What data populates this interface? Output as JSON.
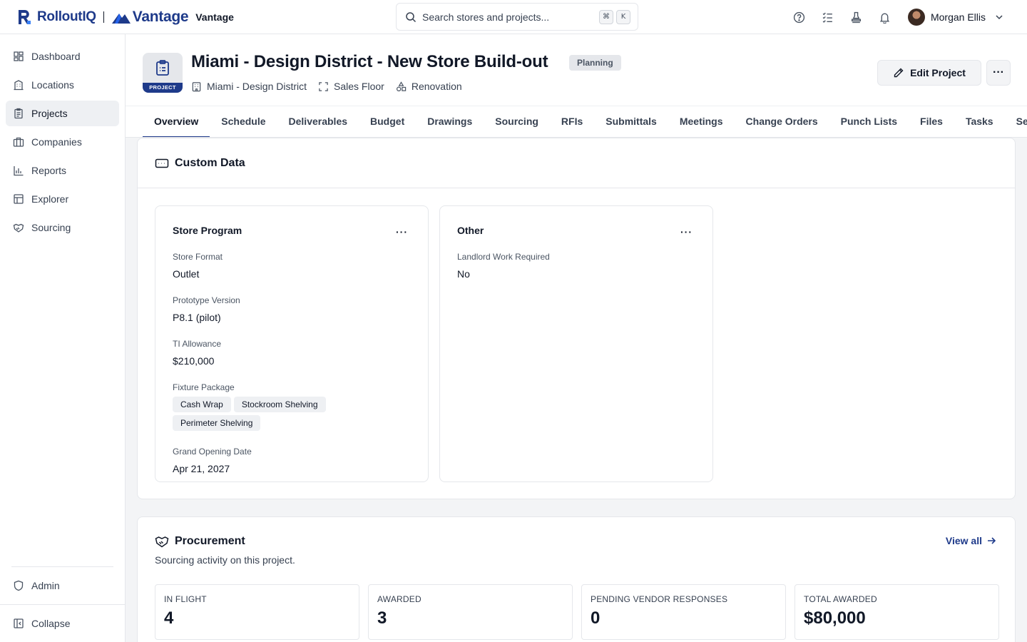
{
  "brand": {
    "name": "RolloutIQ",
    "partner_name": "Vantage",
    "partner_sub": "Vantage"
  },
  "search": {
    "placeholder": "Search stores and projects...",
    "shortcut_key1": "⌘",
    "shortcut_key2": "K"
  },
  "user": {
    "name": "Morgan Ellis"
  },
  "sidebar": {
    "items": [
      {
        "label": "Dashboard",
        "icon": "dashboard-icon"
      },
      {
        "label": "Locations",
        "icon": "building-icon"
      },
      {
        "label": "Projects",
        "icon": "clipboard-icon",
        "active": true
      },
      {
        "label": "Companies",
        "icon": "briefcase-icon"
      },
      {
        "label": "Reports",
        "icon": "bar-chart-icon"
      },
      {
        "label": "Explorer",
        "icon": "table-icon"
      },
      {
        "label": "Sourcing",
        "icon": "handshake-icon"
      }
    ],
    "admin": "Admin",
    "collapse": "Collapse"
  },
  "project": {
    "badge": "PROJECT",
    "title": "Miami - Design District - New Store Build-out",
    "status": "Planning",
    "meta": {
      "location": "Miami - Design District",
      "area": "Sales Floor",
      "type": "Renovation"
    },
    "edit_label": "Edit Project",
    "more_label": "···"
  },
  "tabs": [
    "Overview",
    "Schedule",
    "Deliverables",
    "Budget",
    "Drawings",
    "Sourcing",
    "RFIs",
    "Submittals",
    "Meetings",
    "Change Orders",
    "Punch Lists",
    "Files",
    "Tasks",
    "Se"
  ],
  "custom_data": {
    "title": "Custom Data",
    "store_program": {
      "title": "Store Program",
      "more": "···",
      "store_format_label": "Store Format",
      "store_format": "Outlet",
      "prototype_label": "Prototype Version",
      "prototype": "P8.1 (pilot)",
      "ti_label": "TI Allowance",
      "ti": "$210,000",
      "fixture_label": "Fixture Package",
      "fixtures": [
        "Cash Wrap",
        "Stockroom Shelving",
        "Perimeter Shelving"
      ],
      "opening_label": "Grand Opening Date",
      "opening": "Apr 21, 2027"
    },
    "other": {
      "title": "Other",
      "more": "···",
      "landlord_label": "Landlord Work Required",
      "landlord": "No"
    }
  },
  "procurement": {
    "title": "Procurement",
    "subtitle": "Sourcing activity on this project.",
    "view_all": "View all",
    "stats": [
      {
        "label": "IN FLIGHT",
        "value": "4"
      },
      {
        "label": "AWARDED",
        "value": "3"
      },
      {
        "label": "PENDING VENDOR RESPONSES",
        "value": "0"
      },
      {
        "label": "TOTAL AWARDED",
        "value": "$80,000"
      }
    ]
  }
}
